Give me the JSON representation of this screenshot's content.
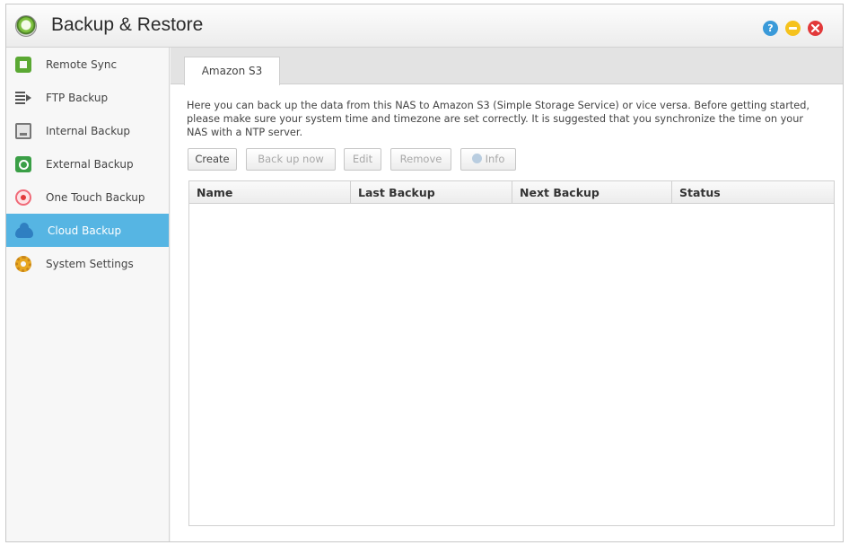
{
  "window": {
    "title": "Backup & Restore",
    "controls": {
      "help": "?",
      "minimize": "",
      "close": ""
    }
  },
  "sidebar": {
    "items": [
      {
        "label": "Remote Sync",
        "icon": "remote-sync-icon",
        "active": false
      },
      {
        "label": "FTP Backup",
        "icon": "ftp-backup-icon",
        "active": false
      },
      {
        "label": "Internal Backup",
        "icon": "internal-backup-icon",
        "active": false
      },
      {
        "label": "External Backup",
        "icon": "external-backup-icon",
        "active": false
      },
      {
        "label": "One Touch Backup",
        "icon": "one-touch-backup-icon",
        "active": false
      },
      {
        "label": "Cloud Backup",
        "icon": "cloud-icon",
        "active": true
      },
      {
        "label": "System Settings",
        "icon": "gear-icon",
        "active": false
      }
    ]
  },
  "main": {
    "tabs": [
      {
        "label": "Amazon S3"
      }
    ],
    "description": "Here you can back up the data from this NAS to Amazon S3 (Simple Storage Service) or vice versa. Before getting started, please make sure your system time and timezone are set correctly. It is suggested that you synchronize the time on your NAS with a NTP server.",
    "toolbar": {
      "create": "Create",
      "backup_now": "Back up now",
      "edit": "Edit",
      "remove": "Remove",
      "info": "Info"
    },
    "table": {
      "columns": [
        "Name",
        "Last Backup",
        "Next Backup",
        "Status"
      ],
      "rows": []
    }
  },
  "colors": {
    "active_item": "#56b5e3",
    "help": "#3a9ad9",
    "minimize": "#f5c21d",
    "close": "#e2393a"
  }
}
